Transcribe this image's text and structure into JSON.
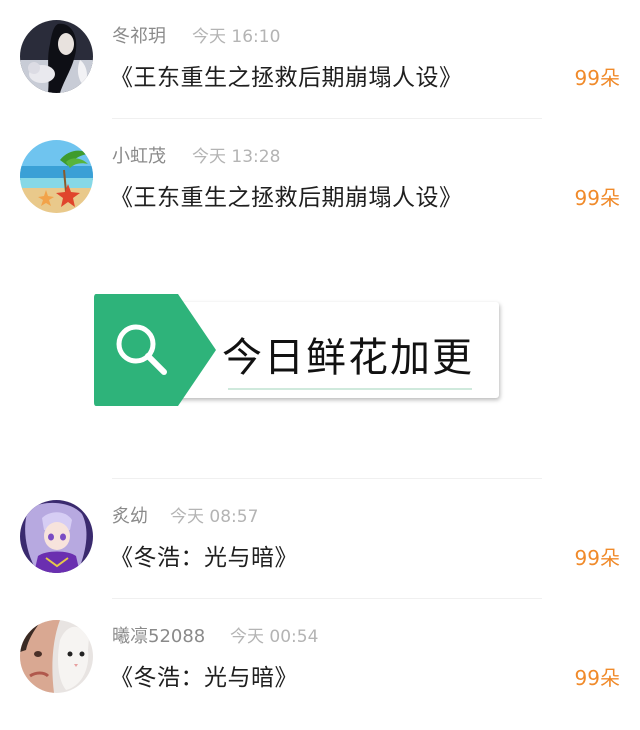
{
  "items": [
    {
      "user": "冬祁玥",
      "time": "今天 16:10",
      "book": "《王东重生之拯救后期崩塌人设》",
      "flowers": "99朵"
    },
    {
      "user": "小虹茂",
      "time": "今天 13:28",
      "book": "《王东重生之拯救后期崩塌人设》",
      "flowers": "99朵"
    },
    {
      "user": "炙幼",
      "time": "今天 08:57",
      "book": "《冬浩：光与暗》",
      "flowers": "99朵"
    },
    {
      "user": "曦凛52088",
      "time": "今天 00:54",
      "book": "《冬浩：光与暗》",
      "flowers": "99朵"
    }
  ],
  "banner": {
    "text": "今日鲜花加更",
    "icon": "search-icon",
    "color": "#2eb37a"
  },
  "colors": {
    "accent": "#f08a2a",
    "name": "#8a8a8a",
    "time": "#b4b4b4",
    "title": "#1f1f1f"
  }
}
